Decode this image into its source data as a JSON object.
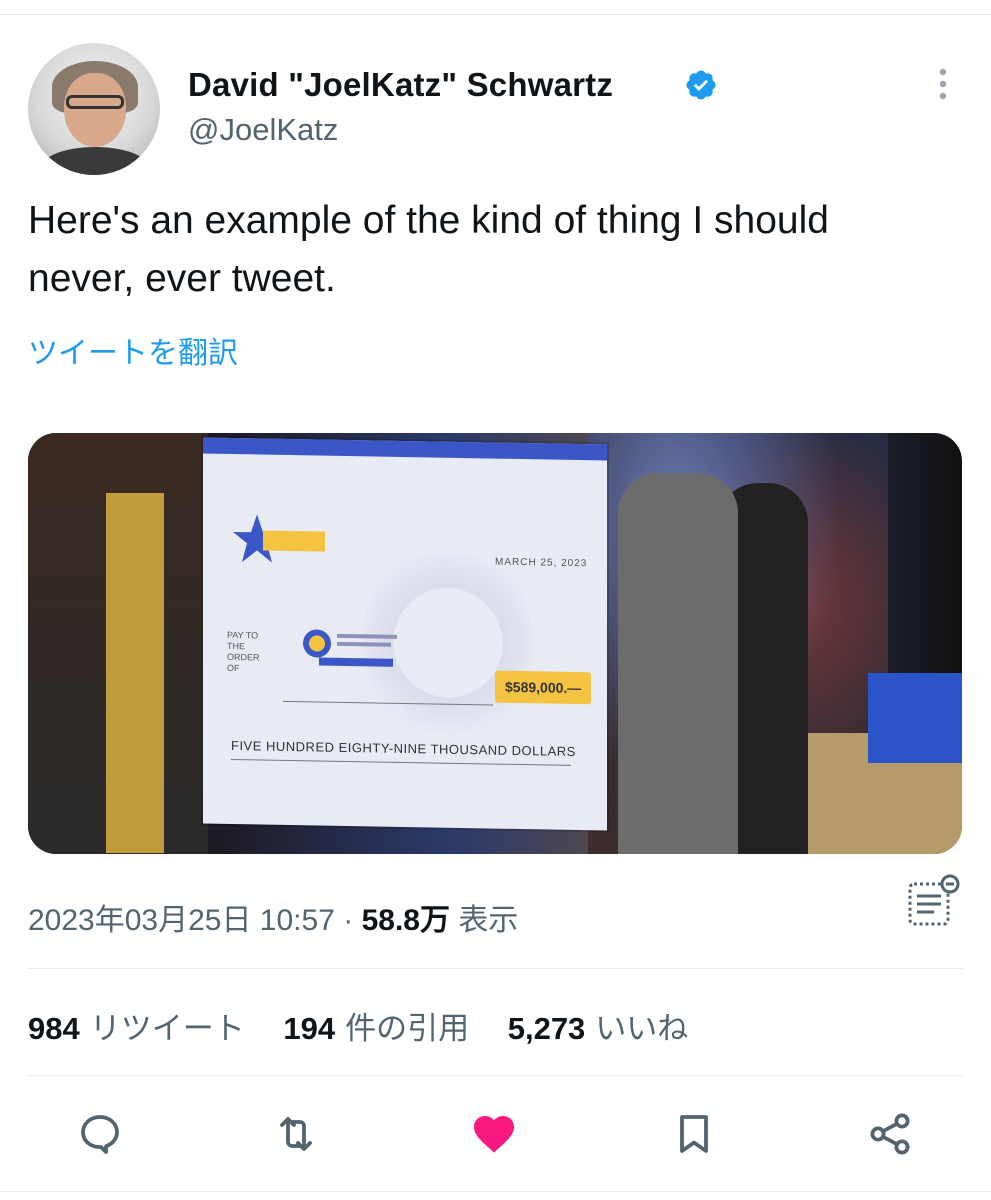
{
  "author": {
    "name": "David \"JoelKatz\" Schwartz",
    "handle": "@JoelKatz",
    "verified": true
  },
  "tweet": {
    "text": "Here's an example of the kind of thing I should never, ever tweet.",
    "translate_label": "ツイートを翻訳"
  },
  "media": {
    "check_date": "MARCH 25, 2023",
    "check_pay_label": "PAY TO THE ORDER OF",
    "check_amount": "$589,000.—",
    "check_amount_words": "FIVE HUNDRED EIGHTY-NINE THOUSAND DOLLARS"
  },
  "meta": {
    "timestamp": "2023年03月25日 10:57",
    "separator": "·",
    "views_count": "58.8万",
    "views_label": "表示"
  },
  "stats": {
    "retweets_count": "984",
    "retweets_label": "リツイート",
    "quotes_count": "194",
    "quotes_label": "件の引用",
    "likes_count": "5,273",
    "likes_label": "いいね"
  },
  "colors": {
    "accent": "#1d9bf0",
    "like": "#f91880",
    "secondary_text": "#536471",
    "verified": "#1d9bf0"
  },
  "icons": [
    "verified-badge-icon",
    "more-options-icon",
    "analytics-icon",
    "reply-icon",
    "retweet-icon",
    "like-icon",
    "bookmark-icon",
    "share-icon"
  ]
}
